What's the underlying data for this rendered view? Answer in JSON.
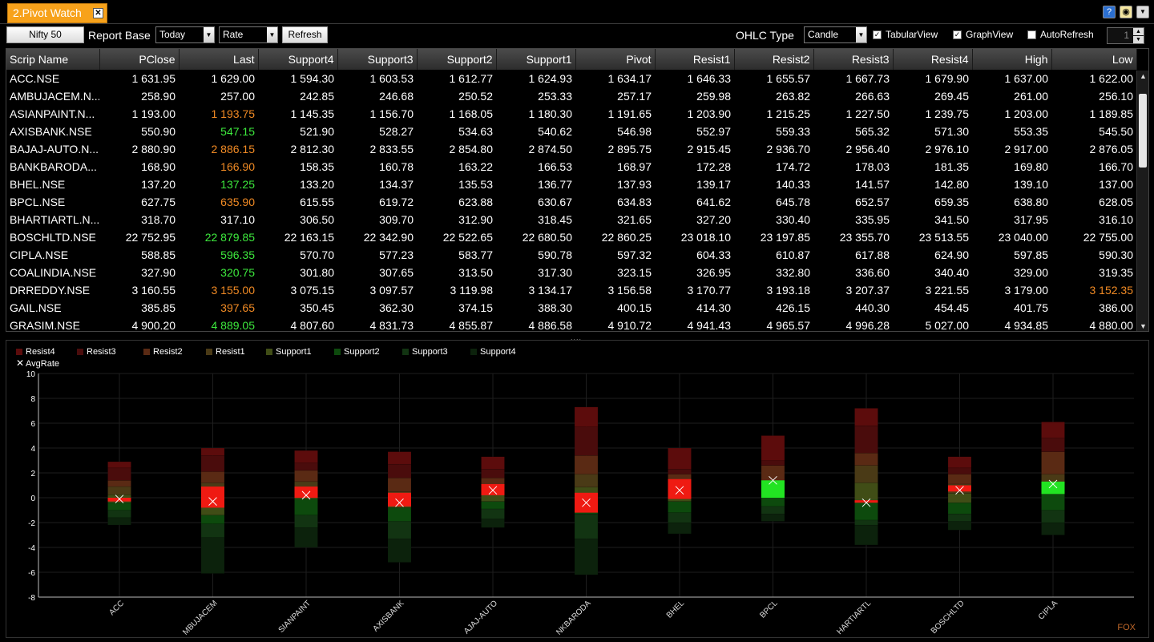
{
  "window": {
    "tab_title": "2.Pivot Watch",
    "close_glyph": "✕",
    "icons": [
      "help-icon",
      "bulb-icon",
      "dropdown-icon"
    ]
  },
  "toolbar": {
    "index_button": "Nifty 50",
    "report_base_label": "Report Base",
    "period_value": "Today",
    "mode_value": "Rate",
    "refresh_label": "Refresh",
    "ohlc_label": "OHLC Type",
    "ohlc_value": "Candle",
    "tabular_label": "TabularView",
    "tabular_checked": true,
    "graph_label": "GraphView",
    "graph_checked": true,
    "autorefresh_label": "AutoRefresh",
    "autorefresh_checked": false,
    "spinner_value": "1"
  },
  "table": {
    "columns": [
      "Scrip Name",
      "PClose",
      "Last",
      "Support4",
      "Support3",
      "Support2",
      "Support1",
      "Pivot",
      "Resist1",
      "Resist2",
      "Resist3",
      "Resist4",
      "High",
      "Low"
    ],
    "rows": [
      {
        "name": "ACC.NSE",
        "pclose": "1 631.95",
        "last": "1 629.00",
        "last_dir": "",
        "s4": "1 594.30",
        "s3": "1 603.53",
        "s2": "1 612.77",
        "s1": "1 624.93",
        "pivot": "1 634.17",
        "r1": "1 646.33",
        "r2": "1 655.57",
        "r3": "1 667.73",
        "r4": "1 679.90",
        "high": "1 637.00",
        "low": "1 622.00",
        "low_dir": ""
      },
      {
        "name": "AMBUJACEM.N...",
        "pclose": "258.90",
        "last": "257.00",
        "last_dir": "",
        "s4": "242.85",
        "s3": "246.68",
        "s2": "250.52",
        "s1": "253.33",
        "pivot": "257.17",
        "r1": "259.98",
        "r2": "263.82",
        "r3": "266.63",
        "r4": "269.45",
        "high": "261.00",
        "low": "256.10",
        "low_dir": ""
      },
      {
        "name": "ASIANPAINT.N...",
        "pclose": "1 193.00",
        "last": "1 193.75",
        "last_dir": "down",
        "s4": "1 145.35",
        "s3": "1 156.70",
        "s2": "1 168.05",
        "s1": "1 180.30",
        "pivot": "1 191.65",
        "r1": "1 203.90",
        "r2": "1 215.25",
        "r3": "1 227.50",
        "r4": "1 239.75",
        "high": "1 203.00",
        "low": "1 189.85",
        "low_dir": ""
      },
      {
        "name": "AXISBANK.NSE",
        "pclose": "550.90",
        "last": "547.15",
        "last_dir": "up",
        "s4": "521.90",
        "s3": "528.27",
        "s2": "534.63",
        "s1": "540.62",
        "pivot": "546.98",
        "r1": "552.97",
        "r2": "559.33",
        "r3": "565.32",
        "r4": "571.30",
        "high": "553.35",
        "low": "545.50",
        "low_dir": ""
      },
      {
        "name": "BAJAJ-AUTO.N...",
        "pclose": "2 880.90",
        "last": "2 886.15",
        "last_dir": "down",
        "s4": "2 812.30",
        "s3": "2 833.55",
        "s2": "2 854.80",
        "s1": "2 874.50",
        "pivot": "2 895.75",
        "r1": "2 915.45",
        "r2": "2 936.70",
        "r3": "2 956.40",
        "r4": "2 976.10",
        "high": "2 917.00",
        "low": "2 876.05",
        "low_dir": ""
      },
      {
        "name": "BANKBARODA...",
        "pclose": "168.90",
        "last": "166.90",
        "last_dir": "down",
        "s4": "158.35",
        "s3": "160.78",
        "s2": "163.22",
        "s1": "166.53",
        "pivot": "168.97",
        "r1": "172.28",
        "r2": "174.72",
        "r3": "178.03",
        "r4": "181.35",
        "high": "169.80",
        "low": "166.70",
        "low_dir": ""
      },
      {
        "name": "BHEL.NSE",
        "pclose": "137.20",
        "last": "137.25",
        "last_dir": "up",
        "s4": "133.20",
        "s3": "134.37",
        "s2": "135.53",
        "s1": "136.77",
        "pivot": "137.93",
        "r1": "139.17",
        "r2": "140.33",
        "r3": "141.57",
        "r4": "142.80",
        "high": "139.10",
        "low": "137.00",
        "low_dir": ""
      },
      {
        "name": "BPCL.NSE",
        "pclose": "627.75",
        "last": "635.90",
        "last_dir": "down",
        "s4": "615.55",
        "s3": "619.72",
        "s2": "623.88",
        "s1": "630.67",
        "pivot": "634.83",
        "r1": "641.62",
        "r2": "645.78",
        "r3": "652.57",
        "r4": "659.35",
        "high": "638.80",
        "low": "628.05",
        "low_dir": ""
      },
      {
        "name": "BHARTIARTL.N...",
        "pclose": "318.70",
        "last": "317.10",
        "last_dir": "",
        "s4": "306.50",
        "s3": "309.70",
        "s2": "312.90",
        "s1": "318.45",
        "pivot": "321.65",
        "r1": "327.20",
        "r2": "330.40",
        "r3": "335.95",
        "r4": "341.50",
        "high": "317.95",
        "low": "316.10",
        "low_dir": ""
      },
      {
        "name": "BOSCHLTD.NSE",
        "pclose": "22 752.95",
        "last": "22 879.85",
        "last_dir": "up",
        "s4": "22 163.15",
        "s3": "22 342.90",
        "s2": "22 522.65",
        "s1": "22 680.50",
        "pivot": "22 860.25",
        "r1": "23 018.10",
        "r2": "23 197.85",
        "r3": "23 355.70",
        "r4": "23 513.55",
        "high": "23 040.00",
        "low": "22 755.00",
        "low_dir": ""
      },
      {
        "name": "CIPLA.NSE",
        "pclose": "588.85",
        "last": "596.35",
        "last_dir": "up",
        "s4": "570.70",
        "s3": "577.23",
        "s2": "583.77",
        "s1": "590.78",
        "pivot": "597.32",
        "r1": "604.33",
        "r2": "610.87",
        "r3": "617.88",
        "r4": "624.90",
        "high": "597.85",
        "low": "590.30",
        "low_dir": ""
      },
      {
        "name": "COALINDIA.NSE",
        "pclose": "327.90",
        "last": "320.75",
        "last_dir": "up",
        "s4": "301.80",
        "s3": "307.65",
        "s2": "313.50",
        "s1": "317.30",
        "pivot": "323.15",
        "r1": "326.95",
        "r2": "332.80",
        "r3": "336.60",
        "r4": "340.40",
        "high": "329.00",
        "low": "319.35",
        "low_dir": ""
      },
      {
        "name": "DRREDDY.NSE",
        "pclose": "3 160.55",
        "last": "3 155.00",
        "last_dir": "down",
        "s4": "3 075.15",
        "s3": "3 097.57",
        "s2": "3 119.98",
        "s1": "3 134.17",
        "pivot": "3 156.58",
        "r1": "3 170.77",
        "r2": "3 193.18",
        "r3": "3 207.37",
        "r4": "3 221.55",
        "high": "3 179.00",
        "low": "3 152.35",
        "low_dir": "down"
      },
      {
        "name": "GAIL.NSE",
        "pclose": "385.85",
        "last": "397.65",
        "last_dir": "down",
        "s4": "350.45",
        "s3": "362.30",
        "s2": "374.15",
        "s1": "388.30",
        "pivot": "400.15",
        "r1": "414.30",
        "r2": "426.15",
        "r3": "440.30",
        "r4": "454.45",
        "high": "401.75",
        "low": "386.00",
        "low_dir": ""
      },
      {
        "name": "GRASIM.NSE",
        "pclose": "4 900.20",
        "last": "4 889.05",
        "last_dir": "up",
        "s4": "4 807.60",
        "s3": "4 831.73",
        "s2": "4 855.87",
        "s1": "4 886.58",
        "pivot": "4 910.72",
        "r1": "4 941.43",
        "r2": "4 965.57",
        "r3": "4 996.28",
        "r4": "5 027.00",
        "high": "4 934.85",
        "low": "4 880.00",
        "low_dir": ""
      }
    ]
  },
  "legend": [
    {
      "name": "Resist4",
      "color": "#5c0c0c"
    },
    {
      "name": "Resist3",
      "color": "#4a0c0c"
    },
    {
      "name": "Resist2",
      "color": "#5a2a14"
    },
    {
      "name": "Resist1",
      "color": "#4a3a16"
    },
    {
      "name": "Support1",
      "color": "#404d16"
    },
    {
      "name": "Support2",
      "color": "#0d4a0d"
    },
    {
      "name": "Support3",
      "color": "#123412"
    },
    {
      "name": "Support4",
      "color": "#0c220c"
    }
  ],
  "avg_rate_label": "AvgRate",
  "brand": "FOX",
  "chart_data": {
    "type": "bar",
    "ylim": [
      -8,
      10
    ],
    "yticks": [
      -8,
      -6,
      -4,
      -2,
      0,
      2,
      4,
      6,
      8,
      10
    ],
    "grid": true,
    "legend_position": "top-left",
    "categories": [
      "ACC",
      "AMBUJACEM",
      "ASIANPAINT",
      "AXISBANK",
      "BAJAJ-AUTO",
      "BANKBARODA",
      "BHEL",
      "BPCL",
      "BHARTIARTL",
      "BOSCHLTD",
      "CIPLA"
    ],
    "category_labels": [
      "ACC",
      "MBUJACEM",
      "SIANPAINT",
      "AXISBANK",
      "AJAJ-AUTO",
      "NKBARODA",
      "BHEL",
      "BPCL",
      "HARTIARTL",
      "BOSCHLTD",
      "CIPLA"
    ],
    "series": [
      {
        "name": "Support4",
        "values": [
          -2.2,
          -6.1,
          -4.0,
          -5.2,
          -2.4,
          -6.2,
          -2.9,
          -1.9,
          -3.8,
          -2.6,
          -3.0
        ]
      },
      {
        "name": "Support3",
        "values": [
          -1.6,
          -3.2,
          -2.4,
          -3.3,
          -1.7,
          -3.3,
          -2.0,
          -1.3,
          -2.2,
          -1.9,
          -2.0
        ]
      },
      {
        "name": "Support2",
        "values": [
          -1.0,
          -2.1,
          -1.4,
          -1.9,
          -0.9,
          -1.3,
          -1.2,
          -0.7,
          -1.8,
          -1.3,
          -1.0
        ]
      },
      {
        "name": "Support1",
        "values": [
          -0.4,
          -1.4,
          -0.1,
          -0.8,
          -0.3,
          -0.2,
          -0.3,
          0.2,
          -0.2,
          -0.4,
          0.3
        ]
      },
      {
        "name": "Resist1",
        "values": [
          0.9,
          1.2,
          1.3,
          0.5,
          0.9,
          1.9,
          1.1,
          1.3,
          2.6,
          1.1,
          1.9
        ]
      },
      {
        "name": "Resist2",
        "values": [
          1.4,
          2.1,
          2.2,
          1.6,
          1.6,
          3.4,
          1.9,
          2.6,
          3.6,
          1.9,
          3.7
        ]
      },
      {
        "name": "Resist3",
        "values": [
          2.4,
          3.4,
          2.8,
          2.7,
          2.3,
          5.7,
          2.3,
          3.0,
          5.8,
          2.4,
          4.8
        ]
      },
      {
        "name": "Resist4",
        "values": [
          2.9,
          4.0,
          3.8,
          3.7,
          3.3,
          7.3,
          4.0,
          5.0,
          7.2,
          3.3,
          6.1
        ]
      }
    ],
    "candles": [
      {
        "open": 0.0,
        "close": -0.3,
        "color": "red"
      },
      {
        "open": 0.9,
        "close": -0.8,
        "color": "red"
      },
      {
        "open": 0.9,
        "close": 0.0,
        "color": "red"
      },
      {
        "open": 0.4,
        "close": -0.7,
        "color": "red"
      },
      {
        "open": 1.1,
        "close": 0.2,
        "color": "red"
      },
      {
        "open": 0.4,
        "close": -1.2,
        "color": "red"
      },
      {
        "open": 1.5,
        "close": -0.1,
        "color": "red"
      },
      {
        "open": 1.4,
        "close": 0.0,
        "color": "green"
      },
      {
        "open": -0.2,
        "close": -0.4,
        "color": "red"
      },
      {
        "open": 1.0,
        "close": 0.5,
        "color": "red"
      },
      {
        "open": 1.3,
        "close": 0.3,
        "color": "green"
      }
    ],
    "avg_rate": [
      -0.1,
      -0.3,
      0.2,
      -0.4,
      0.6,
      -0.4,
      0.6,
      1.4,
      -0.4,
      0.6,
      1.1
    ]
  }
}
